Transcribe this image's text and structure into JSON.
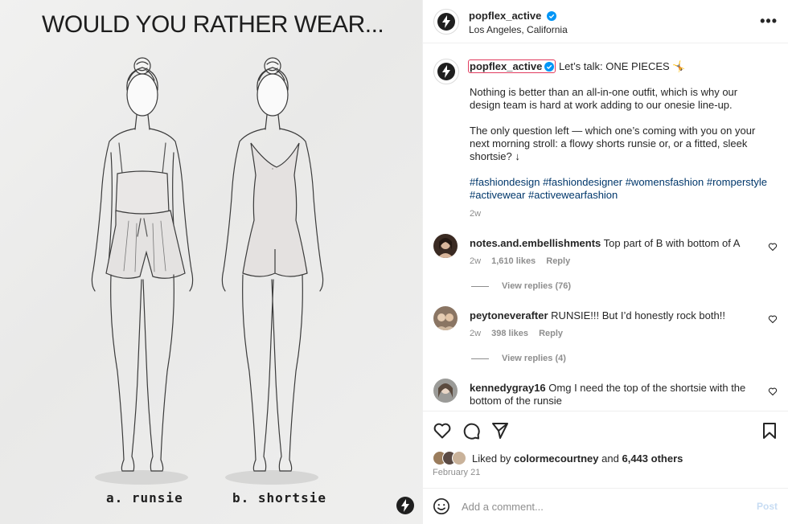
{
  "media": {
    "title": "WOULD YOU RATHER WEAR...",
    "label_a": "a. runsie",
    "label_b": "b. shortsie",
    "brand_icon": "popflex-bolt-logo"
  },
  "header": {
    "username": "popflex_active",
    "verified": true,
    "location": "Los Angeles, California",
    "more_icon": "more-horizontal-icon",
    "more_label": "•••"
  },
  "caption": {
    "username": "popflex_active",
    "lead": "Let’s talk: ONE PIECES 🤸",
    "para1": "Nothing is better than an all-in-one outfit, which is why our design team is hard at work adding to our onesie line-up.",
    "para2": "The only question left — which one’s coming with you on your next morning stroll: a flowy shorts runsie or, or a fitted, sleek shortsie? ↓",
    "hashtags": "#fashiondesign #fashiondesigner #womensfashion #romperstyle #activewear #activewearfashion",
    "time": "2w"
  },
  "comments": [
    {
      "username": "notes.and.embellishments",
      "text": "Top part of B with bottom of A",
      "time": "2w",
      "likes": "1,610 likes",
      "reply": "Reply",
      "view_replies": "View replies (76)"
    },
    {
      "username": "peytoneverafter",
      "text": "RUNSIE!!! But I’d honestly rock both!!",
      "time": "2w",
      "likes": "398 likes",
      "reply": "Reply",
      "view_replies": "View replies (4)"
    },
    {
      "username": "kennedygray16",
      "text": "Omg I need the top of the shortsie with the bottom of the runsie"
    }
  ],
  "actions": {
    "icons": [
      "heart-icon",
      "comment-icon",
      "share-icon",
      "bookmark-icon"
    ],
    "liked_by_prefix": "Liked by",
    "liked_by_user": "colormecourtney",
    "liked_by_and": "and",
    "liked_by_others": "6,443 others",
    "date": "February 21"
  },
  "comment_box": {
    "placeholder": "Add a comment...",
    "post_label": "Post"
  },
  "colors": {
    "link_blue": "#00376b",
    "verified_blue": "#0095f6",
    "muted": "#8e8e8e",
    "post_disabled": "#c7dcf3",
    "caption_highlight": "#e23c5f"
  }
}
